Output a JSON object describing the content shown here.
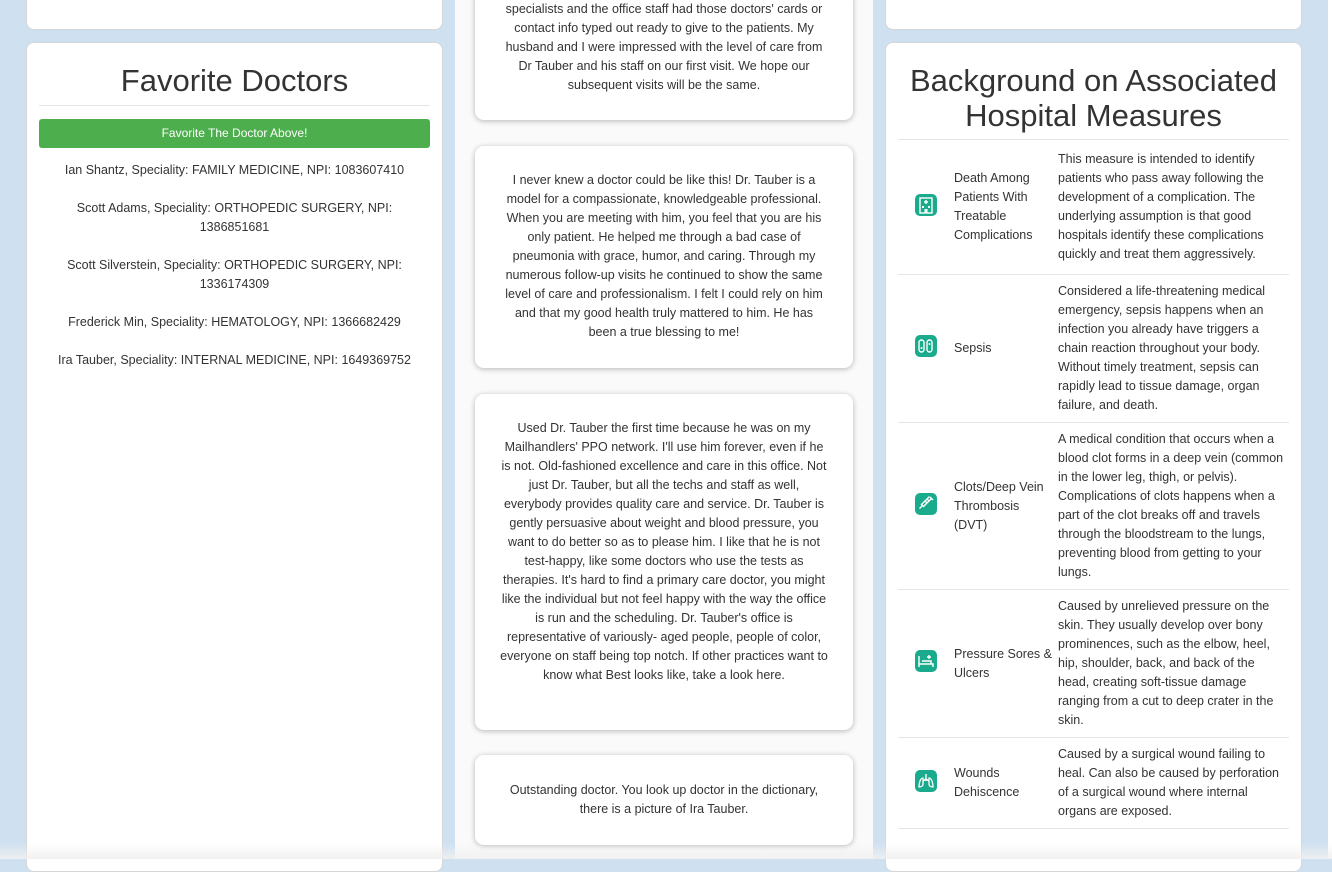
{
  "favorites": {
    "title": "Favorite Doctors",
    "button_label": "Favorite The Doctor Above!",
    "doctors": [
      "Ian Shantz, Speciality: FAMILY MEDICINE, NPI: 1083607410",
      "Scott Adams, Speciality: ORTHOPEDIC SURGERY, NPI: 1386851681",
      "Scott Silverstein, Speciality: ORTHOPEDIC SURGERY, NPI: 1336174309",
      "Frederick Min, Speciality: HEMATOLOGY, NPI: 1366682429",
      "Ira Tauber, Speciality: INTERNAL MEDICINE, NPI: 1649369752"
    ]
  },
  "reviews": [
    "specialists and the office staff had those doctors' cards or contact info typed out ready to give to the patients. My husband and I were impressed with the level of care from Dr Tauber and his staff on our first visit. We hope our subsequent visits will be the same.",
    "I never knew a doctor could be like this! Dr. Tauber is a model for a compassionate, knowledgeable professional. When you are meeting with him, you feel that you are his only patient. He helped me through a bad case of pneumonia with grace, humor, and caring. Through my numerous follow-up visits he continued to show the same level of care and professionalism. I felt I could rely on him and that my good health truly mattered to him. He has been a true blessing to me!",
    "Used Dr. Tauber the first time because he was on my Mailhandlers' PPO network. I'll use him forever, even if he is not. Old-fashioned excellence and care in this office. Not just Dr. Tauber, but all the techs and staff as well, everybody provides quality care and service. Dr. Tauber is gently persuasive about weight and blood pressure, you want to do better so as to please him. I like that he is not test-happy, like some doctors who use the tests as therapies. It's hard to find a primary care doctor, you might like the individual but not feel happy with the way the office is run and the scheduling. Dr. Tauber's office is representative of variously- aged people, people of color, everyone on staff being top notch. If other practices want to know what Best looks like, take a look here.",
    "Outstanding doctor. You look up doctor in the dictionary, there is a picture of Ira Tauber."
  ],
  "measures": {
    "title": "Background on Associated Hospital Measures",
    "icon_color": "#1aaa8c",
    "items": [
      {
        "icon": "hospital-building-icon",
        "name": "Death Among Patients With Treatable Complications",
        "description": "This measure is intended to identify patients who pass away following the development of a complication. The underlying assumption is that good hospitals identify these complications quickly and treat them aggressively."
      },
      {
        "icon": "bacteria-icon",
        "name": "Sepsis",
        "description": "Considered a life-threatening medical emergency, sepsis happens when an infection you already have triggers a chain reaction throughout your body. Without timely treatment, sepsis can rapidly lead to tissue damage, organ failure, and death."
      },
      {
        "icon": "syringe-icon",
        "name": "Clots/Deep Vein Thrombosis (DVT)",
        "description": "A medical condition that occurs when a blood clot forms in a deep vein (common in the lower leg, thigh, or pelvis). Complications of clots happens when a part of the clot breaks off and travels through the bloodstream to the lungs, preventing blood from getting to your lungs."
      },
      {
        "icon": "hospital-bed-icon",
        "name": "Pressure Sores & Ulcers",
        "description": "Caused by unrelieved pressure on the skin. They usually develop over bony prominences, such as the elbow, heel, hip, shoulder, back, and back of the head, creating soft-tissue damage ranging from a cut to deep crater in the skin."
      },
      {
        "icon": "lungs-icon",
        "name": "Wounds Dehiscence",
        "description": "Caused by a surgical wound failing to heal. Can also be caused by perforation of a surgical wound where internal organs are exposed."
      }
    ]
  }
}
